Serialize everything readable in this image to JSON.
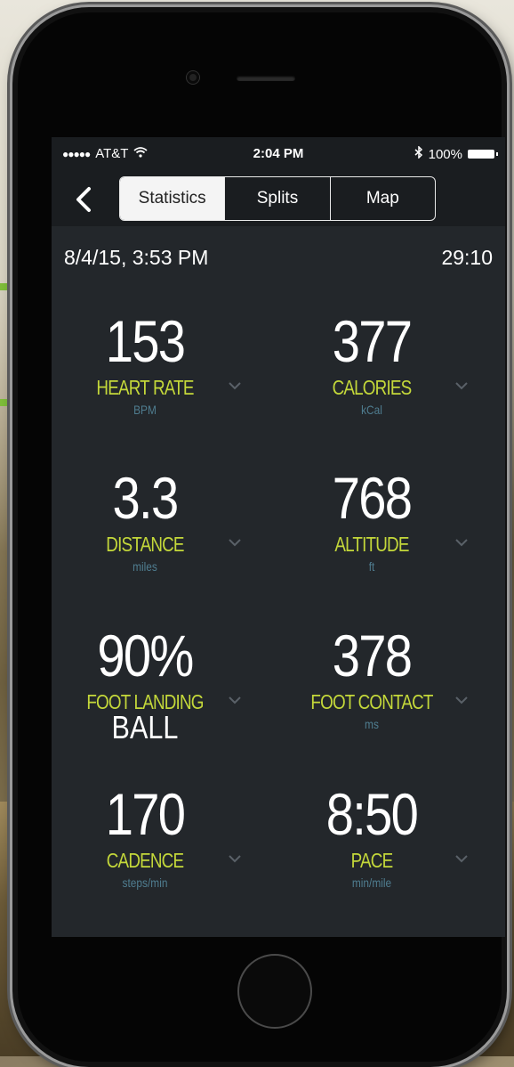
{
  "status_bar": {
    "carrier": "AT&T",
    "time": "2:04 PM",
    "battery": "100%"
  },
  "nav": {
    "tabs": [
      {
        "label": "Statistics",
        "active": true
      },
      {
        "label": "Splits",
        "active": false
      },
      {
        "label": "Map",
        "active": false
      }
    ]
  },
  "workout": {
    "date": "8/4/15, 3:53 PM",
    "duration": "29:10"
  },
  "stats": [
    {
      "value": "153",
      "suffix": "",
      "label": "HEART RATE",
      "unit": "BPM"
    },
    {
      "value": "377",
      "suffix": "",
      "label": "CALORIES",
      "unit": "kCal"
    },
    {
      "value": "3.3",
      "suffix": "",
      "label": "DISTANCE",
      "unit": "miles"
    },
    {
      "value": "768",
      "suffix": "",
      "label": "ALTITUDE",
      "unit": "ft"
    },
    {
      "value": "90%",
      "suffix": "BALL",
      "label": "FOOT LANDING",
      "unit": ""
    },
    {
      "value": "378",
      "suffix": "",
      "label": "FOOT CONTACT",
      "unit": "ms"
    },
    {
      "value": "170",
      "suffix": "",
      "label": "CADENCE",
      "unit": "steps/min"
    },
    {
      "value": "8:50",
      "suffix": "",
      "label": "PACE",
      "unit": "min/mile"
    }
  ],
  "colors": {
    "screen_bg": "#23272b",
    "bar_bg": "#1a1d20",
    "label_accent": "#c4d83a",
    "unit_text": "#4f7d90"
  }
}
